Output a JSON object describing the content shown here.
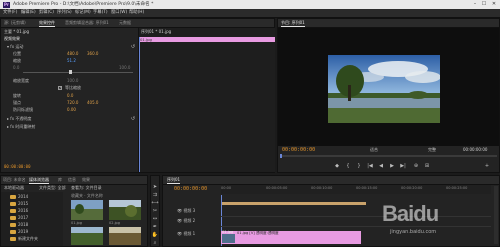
{
  "window": {
    "title": "Adobe Premiere Pro - D:\\文档\\Adobe\\Premiere Pro\\9.0\\未命名 *",
    "logo": "Pr",
    "controls": [
      "–",
      "☐",
      "✕"
    ]
  },
  "menu": [
    "文件(F)",
    "编辑(E)",
    "剪辑(C)",
    "序列(S)",
    "标记(M)",
    "字幕(T)",
    "窗口(W)",
    "帮助(H)"
  ],
  "source_panel": {
    "tabs": [
      "源: (无剪辑)",
      "效果控件",
      "音频剪辑混合器: 序列01",
      "元数据"
    ],
    "header_clip": "主要 * 01.jpg",
    "header_seq": "序列01 * 01.jpg",
    "section_video": "视频效果",
    "fx_motion": "运动",
    "rows": [
      {
        "label": "位置",
        "value": "480.0",
        "value2": "360.0"
      },
      {
        "label": "缩放",
        "value": "51.2"
      },
      {
        "label": "缩放宽度",
        "value": "100.0"
      },
      {
        "label": "等比缩放",
        "checked": true
      },
      {
        "label": "旋转",
        "value": "0.0"
      },
      {
        "label": "锚点",
        "value": "720.0",
        "value2": "405.0"
      },
      {
        "label": "防闪烁滤镜",
        "value": "0.00"
      }
    ],
    "slider_min": "0.0",
    "slider_max": "100.0",
    "fx_opacity": "不透明度",
    "fx_timeremap": "时间重映射",
    "timeline_clip": "01.jpg",
    "timecode": "00:00:00:00"
  },
  "program_panel": {
    "tab": "节目: 序列01",
    "timecode_left": "00:00:00:00",
    "fit_label": "适合",
    "quality_label": "完整",
    "timecode_right": "00:00:00:00",
    "transport_icons": [
      "◆",
      "{",
      "}",
      "|◀",
      "◀",
      "▶",
      "▶|",
      "⊕",
      "⊞",
      "+"
    ]
  },
  "project_panel": {
    "tabs": [
      "项目: 未命名",
      "媒体浏览器",
      "库",
      "信息",
      "效果"
    ],
    "filter_label": "本地驱动器",
    "file_types": "文件类型: 全部",
    "view_as": "查看为: 文件目录",
    "folders": [
      "2014",
      "2015",
      "2016",
      "2017",
      "2018",
      "2019",
      "新建文件夹"
    ],
    "thumbs_header": "收藏夹 · 文件名称",
    "thumb_labels": [
      "01.jpg",
      "02.jpg",
      "03.jpg",
      "04.jpg"
    ]
  },
  "timeline": {
    "tab": "序列01",
    "timecode": "00:00:00:00",
    "ruler_labels": [
      "00:00",
      "00:00:05:00",
      "00:00:10:00",
      "00:00:15:00",
      "00:00:20:00",
      "00:00:25:00"
    ],
    "tracks": [
      {
        "name": "V3",
        "label": "视频 3"
      },
      {
        "name": "V2",
        "label": "视频 2"
      },
      {
        "name": "V1",
        "label": "视频 1"
      }
    ],
    "clip_label": "01.jpg [V] 透明度:透明度",
    "clip_label_v1": "01.jpg"
  },
  "watermark": {
    "site": "jingyan.baidu.com"
  }
}
